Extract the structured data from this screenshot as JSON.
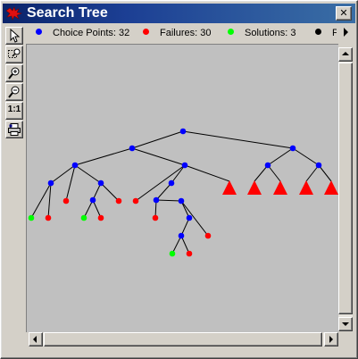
{
  "window": {
    "title": "Search Tree",
    "close_label": "✕"
  },
  "toolbar": {
    "tools": [
      {
        "name": "select-tool",
        "icon": "pointer-icon"
      },
      {
        "name": "region-zoom-tool",
        "icon": "zoom-region-icon"
      },
      {
        "name": "zoom-in-tool",
        "icon": "zoom-in-icon"
      },
      {
        "name": "zoom-out-tool",
        "icon": "zoom-out-icon"
      },
      {
        "name": "actual-size-tool",
        "icon": "one-to-one-icon",
        "label": "1:1"
      },
      {
        "name": "print-tool",
        "icon": "printer-icon"
      }
    ]
  },
  "legend": {
    "items": [
      {
        "label": "Choice Points: 32",
        "color": "#0000ff"
      },
      {
        "label": "Failures: 30",
        "color": "#ff0000"
      },
      {
        "label": "Solutions: 3",
        "color": "#00ff00"
      },
      {
        "label": "P",
        "color": "#000000"
      }
    ]
  },
  "colors": {
    "choice": "#0000ff",
    "failure": "#ff0000",
    "solution": "#00ff00",
    "collapsed": "#ff0000",
    "edge": "#000000"
  },
  "tree": {
    "nodes": [
      {
        "id": "n1",
        "type": "choice",
        "parent": null
      },
      {
        "id": "n2",
        "type": "choice",
        "parent": "n1"
      },
      {
        "id": "n3",
        "type": "choice",
        "parent": "n1"
      },
      {
        "id": "n4",
        "type": "choice",
        "parent": "n2"
      },
      {
        "id": "n5",
        "type": "choice",
        "parent": "n2"
      },
      {
        "id": "n6",
        "type": "choice",
        "parent": "n4"
      },
      {
        "id": "n7",
        "type": "choice",
        "parent": "n4"
      },
      {
        "id": "n8",
        "type": "solution",
        "parent": "n6"
      },
      {
        "id": "n9",
        "type": "failure",
        "parent": "n6"
      },
      {
        "id": "n10",
        "type": "failure",
        "parent": "n4"
      },
      {
        "id": "n11",
        "type": "choice",
        "parent": "n7"
      },
      {
        "id": "n12",
        "type": "solution",
        "parent": "n11"
      },
      {
        "id": "n13",
        "type": "failure",
        "parent": "n11"
      },
      {
        "id": "n14",
        "type": "failure",
        "parent": "n7"
      },
      {
        "id": "n15",
        "type": "choice",
        "parent": "n5"
      },
      {
        "id": "n16",
        "type": "failure",
        "parent": "n5"
      },
      {
        "id": "n17",
        "type": "choice",
        "parent": "n15"
      },
      {
        "id": "n18",
        "type": "failure",
        "parent": "n17"
      },
      {
        "id": "n19",
        "type": "choice",
        "parent": "n17"
      },
      {
        "id": "n20",
        "type": "choice",
        "parent": "n19"
      },
      {
        "id": "n21",
        "type": "failure",
        "parent": "n19"
      },
      {
        "id": "n22",
        "type": "choice",
        "parent": "n20"
      },
      {
        "id": "n23",
        "type": "solution",
        "parent": "n22"
      },
      {
        "id": "n24",
        "type": "failure",
        "parent": "n22"
      },
      {
        "id": "n25",
        "type": "collapsed",
        "parent": "n5"
      },
      {
        "id": "n26",
        "type": "choice",
        "parent": "n3"
      },
      {
        "id": "n27",
        "type": "choice",
        "parent": "n3"
      },
      {
        "id": "n28",
        "type": "collapsed",
        "parent": "n26"
      },
      {
        "id": "n29",
        "type": "collapsed",
        "parent": "n26"
      },
      {
        "id": "n30",
        "type": "collapsed",
        "parent": "n27"
      },
      {
        "id": "n31",
        "type": "collapsed",
        "parent": "n27"
      },
      {
        "id": "n32",
        "type": "collapsed",
        "parent": "n27"
      }
    ]
  }
}
